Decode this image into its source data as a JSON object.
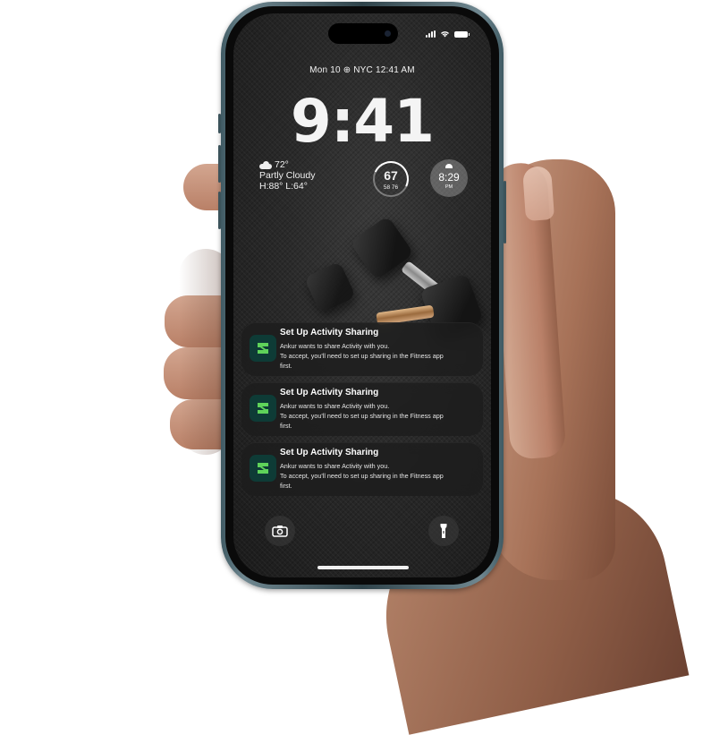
{
  "status_bar": {
    "icons": [
      "signal-icon",
      "wifi-icon",
      "battery-icon"
    ]
  },
  "lock_screen": {
    "date_line": "Mon 10 ⊕ NYC 12:41 AM",
    "time": "9:41"
  },
  "widgets": {
    "weather": {
      "temperature": "72°",
      "condition": "Partly Cloudy",
      "high_low": "H:88° L:64°",
      "icon": "partly-cloudy-icon"
    },
    "temperature_gauge": {
      "value": "67",
      "range": "58  76"
    },
    "sunset_clock": {
      "time": "8:29",
      "period": "PM",
      "icon": "sunset-icon"
    }
  },
  "notifications": [
    {
      "title": "Set Up Activity Sharing",
      "line1": "Ankur wants to share Activity with you.",
      "line2": "To accept, you'll need to set up sharing in the Fitness app",
      "line3": "first.",
      "app_icon": "fitness-app-icon"
    },
    {
      "title": "Set Up Activity Sharing",
      "line1": "Ankur wants to share Activity with you.",
      "line2": "To accept, you'll need to set up sharing in the Fitness app",
      "line3": "first.",
      "app_icon": "fitness-app-icon"
    },
    {
      "title": "Set Up Activity Sharing",
      "line1": "Ankur wants to share Activity with you.",
      "line2": "To accept, you'll need to set up sharing in the Fitness app",
      "line3": "first.",
      "app_icon": "fitness-app-icon"
    }
  ],
  "controls": {
    "left": "camera-icon",
    "right": "flashlight-icon"
  },
  "colors": {
    "fitness_green": "#5fd35a",
    "fitness_bg": "#0e3b36",
    "phone_frame": "#3f5a63"
  }
}
